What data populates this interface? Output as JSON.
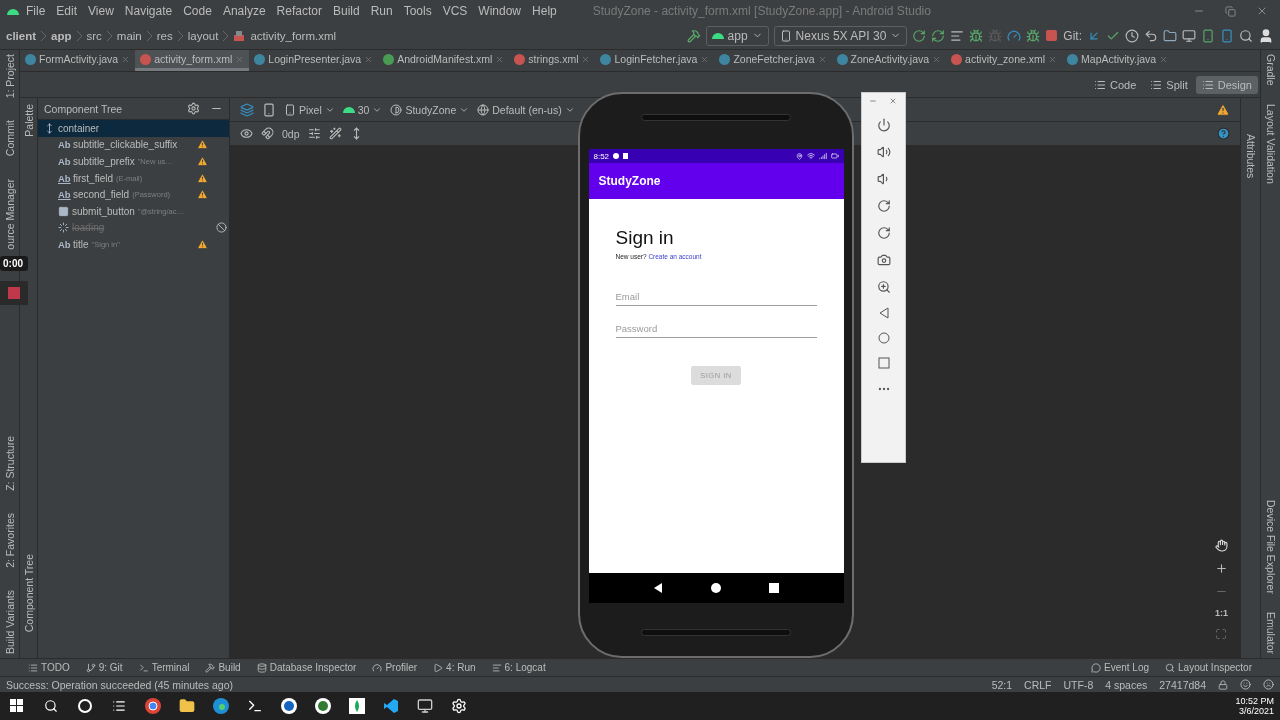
{
  "window": {
    "title": "StudyZone - activity_form.xml [StudyZone.app] - Android Studio"
  },
  "menu": [
    "File",
    "Edit",
    "View",
    "Navigate",
    "Code",
    "Analyze",
    "Refactor",
    "Build",
    "Run",
    "Tools",
    "VCS",
    "Window",
    "Help"
  ],
  "breadcrumbs": [
    {
      "label": "client",
      "kind": "module"
    },
    {
      "label": "app",
      "kind": "module"
    },
    {
      "label": "src",
      "kind": "dir"
    },
    {
      "label": "main",
      "kind": "dir"
    },
    {
      "label": "res",
      "kind": "dir"
    },
    {
      "label": "layout",
      "kind": "dir"
    },
    {
      "label": "activity_form.xml",
      "kind": "file"
    }
  ],
  "run_config": "app",
  "device": "Nexus 5X API 30",
  "git_label": "Git:",
  "tabs": [
    {
      "label": "FormActivity.java",
      "kind": "java",
      "selected": false
    },
    {
      "label": "activity_form.xml",
      "kind": "xml",
      "selected": true
    },
    {
      "label": "LoginPresenter.java",
      "kind": "java",
      "selected": false
    },
    {
      "label": "AndroidManifest.xml",
      "kind": "manifest",
      "selected": false
    },
    {
      "label": "strings.xml",
      "kind": "xml",
      "selected": false
    },
    {
      "label": "LoginFetcher.java",
      "kind": "java",
      "selected": false
    },
    {
      "label": "ZoneFetcher.java",
      "kind": "java",
      "selected": false
    },
    {
      "label": "ZoneActivity.java",
      "kind": "java",
      "selected": false
    },
    {
      "label": "activity_zone.xml",
      "kind": "xml",
      "selected": false
    },
    {
      "label": "MapActivity.java",
      "kind": "java",
      "selected": false
    }
  ],
  "view_modes": [
    {
      "label": "Code",
      "selected": false
    },
    {
      "label": "Split",
      "selected": false
    },
    {
      "label": "Design",
      "selected": true
    }
  ],
  "left_tools_top": [
    "1: Project",
    "Commit",
    "ource Manager"
  ],
  "left_tools_bottom": [
    "Z: Structure",
    "2: Favorites",
    "Build Variants"
  ],
  "palette_tools": [
    "Palette",
    "Component Tree"
  ],
  "right_tools_top": [
    "Gradle",
    "Layout Validation"
  ],
  "right_tools_bottom": [
    "Device File Explorer",
    "Emulator"
  ],
  "attributes_tool": "Attributes",
  "component_tree": {
    "title": "Component Tree",
    "nodes": [
      {
        "label": "container",
        "kind": "layout",
        "selected": true,
        "warning": false,
        "disabled": false,
        "children": [
          {
            "label": "subtitle_clickable_suffix",
            "badge": "Ab",
            "kind": "text",
            "selected": false,
            "warning": true,
            "disabled": false
          },
          {
            "label": "subtitle_prefix",
            "badge": "Ab",
            "hint": "\"New us…",
            "kind": "text",
            "selected": false,
            "warning": true,
            "disabled": false
          },
          {
            "label": "first_field",
            "badge": "Ab",
            "hint": "(E-mail)",
            "kind": "field",
            "selected": false,
            "warning": true,
            "disabled": false
          },
          {
            "label": "second_field",
            "badge": "Ab",
            "hint": "(Password)",
            "kind": "field",
            "selected": false,
            "warning": true,
            "disabled": false
          },
          {
            "label": "submit_button",
            "hint": "\"@string/ac…",
            "kind": "button",
            "selected": false,
            "warning": false,
            "disabled": false
          },
          {
            "label": "loading",
            "kind": "progress",
            "selected": false,
            "warning": false,
            "disabled": true
          },
          {
            "label": "title",
            "badge": "Ab",
            "hint": "\"Sign in\"",
            "kind": "text",
            "selected": false,
            "warning": true,
            "disabled": false
          }
        ]
      }
    ]
  },
  "design_toolbar": {
    "device": "Pixel",
    "api": "30",
    "theme": "StudyZone",
    "locale": "Default (en-us)",
    "margin": "0dp"
  },
  "zoom_reset": "1:1",
  "recorder": {
    "time": "0:00"
  },
  "emulator": {
    "status_time": "8:52",
    "app_title": "StudyZone",
    "heading": "Sign in",
    "subtitle": "New user?",
    "link": "Create an account",
    "fields": [
      {
        "placeholder": "Email"
      },
      {
        "placeholder": "Password"
      }
    ],
    "button": {
      "label": "SIGN IN",
      "disabled": true
    }
  },
  "bottom_tools": [
    "TODO",
    "9: Git",
    "Terminal",
    "Build",
    "Database Inspector",
    "Profiler",
    "4: Run",
    "6: Logcat"
  ],
  "bottom_tools_right": [
    "Event Log",
    "Layout Inspector"
  ],
  "status_bar": {
    "message": "Success: Operation succeeded (45 minutes ago)",
    "items": [
      "52:1",
      "CRLF",
      "UTF-8",
      "4 spaces"
    ],
    "vcs": "27417d84"
  },
  "taskbar": {
    "time": "10:52 PM",
    "date": "3/6/2021"
  }
}
